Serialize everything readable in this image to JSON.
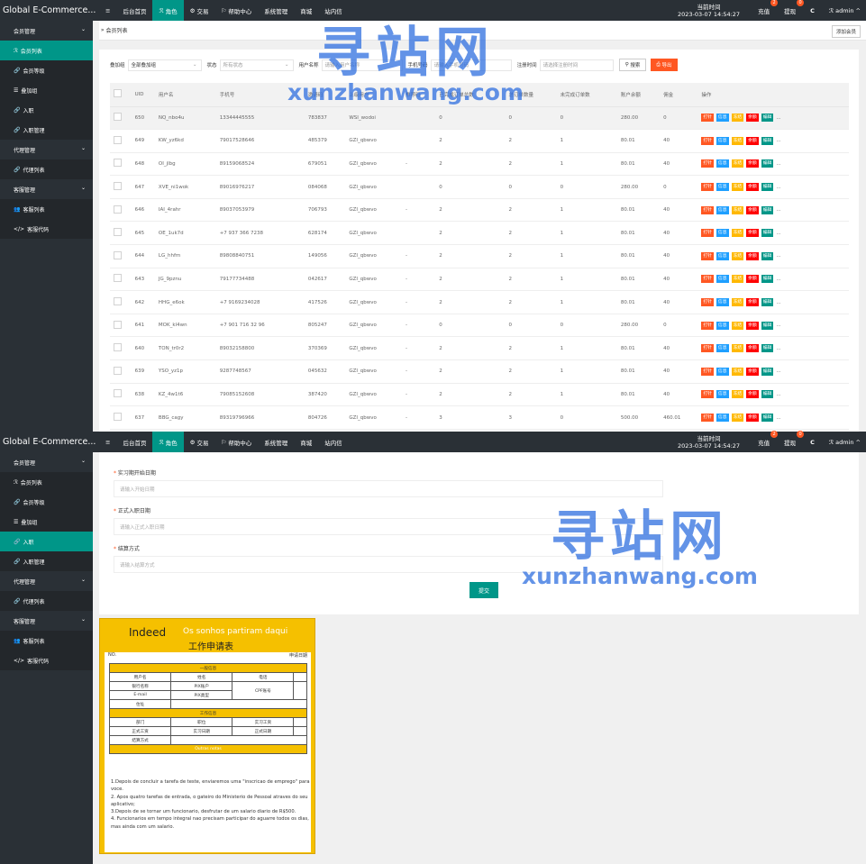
{
  "app": {
    "brand": "Global E-Commerce..."
  },
  "nav": [
    {
      "icon": "≡",
      "label": ""
    },
    {
      "icon": "",
      "label": "后台首页"
    },
    {
      "icon": "ℛ",
      "label": "角色"
    },
    {
      "icon": "⚙",
      "label": "交易"
    },
    {
      "icon": "⚐",
      "label": "帮助中心"
    },
    {
      "icon": "",
      "label": "系统管理"
    },
    {
      "icon": "",
      "label": "商城"
    },
    {
      "icon": "",
      "label": "站内信"
    }
  ],
  "top_right": {
    "time_label": "当前时间",
    "time_value": "2023-03-07 14:54:27",
    "recharge": "充值",
    "recharge_badge": "2",
    "withdraw": "提现",
    "withdraw_badge": "0",
    "refresh_icon": "C",
    "user": "admin"
  },
  "sidebar1": [
    {
      "label": "会员管理",
      "icon": "",
      "type": "group"
    },
    {
      "label": "会员列表",
      "icon": "ℛ",
      "type": "active"
    },
    {
      "label": "会员等级",
      "icon": "🔗",
      "type": "dark"
    },
    {
      "label": "叠加组",
      "icon": "☰",
      "type": "dark"
    },
    {
      "label": "入职",
      "icon": "🔗",
      "type": "dark"
    },
    {
      "label": "入职管理",
      "icon": "🔗",
      "type": "dark"
    },
    {
      "label": "代理管理",
      "icon": "",
      "type": "group"
    },
    {
      "label": "代理列表",
      "icon": "🔗",
      "type": "dark"
    },
    {
      "label": "客服管理",
      "icon": "",
      "type": "group"
    },
    {
      "label": "客服列表",
      "icon": "👥",
      "type": "dark"
    },
    {
      "label": "客服代码",
      "icon": "</>",
      "type": "dark"
    }
  ],
  "sidebar2": [
    {
      "label": "会员管理",
      "icon": "",
      "type": "group"
    },
    {
      "label": "会员列表",
      "icon": "ℛ",
      "type": "dark"
    },
    {
      "label": "会员等级",
      "icon": "🔗",
      "type": "dark"
    },
    {
      "label": "叠加组",
      "icon": "☰",
      "type": "dark"
    },
    {
      "label": "入职",
      "icon": "🔗",
      "type": "active"
    },
    {
      "label": "入职管理",
      "icon": "🔗",
      "type": "dark"
    },
    {
      "label": "代理管理",
      "icon": "",
      "type": "group"
    },
    {
      "label": "代理列表",
      "icon": "🔗",
      "type": "dark"
    },
    {
      "label": "客服管理",
      "icon": "",
      "type": "group"
    },
    {
      "label": "客服列表",
      "icon": "👥",
      "type": "dark"
    },
    {
      "label": "客服代码",
      "icon": "</>",
      "type": "dark"
    }
  ],
  "breadcrumb": "会员列表",
  "add_member": "添加会员",
  "filters": {
    "group_label": "叠加组",
    "group_value": "全部叠加组",
    "status_label": "状态",
    "status_value": "所有状态",
    "user_label": "用户名称",
    "user_placeholder": "请输入用户名称",
    "phone_label": "手机号码",
    "phone_placeholder": "请输入手机号码",
    "reg_label": "注册时间",
    "reg_placeholder": "请选择注册时间",
    "search": "搜索",
    "export": "导出"
  },
  "table": {
    "headers": [
      "",
      "UID",
      "用户名",
      "手机号",
      "邀请码",
      "上级用户",
      "推荐码",
      "已完成订单总数",
      "总订单数量",
      "未完成订单数",
      "账户余额",
      "佣金",
      "操作"
    ],
    "rows": [
      [
        "650",
        "NQ_nbo4u",
        "13344445555",
        "783837",
        "WSI_wodoi",
        "",
        "0",
        "0",
        "0",
        "280.00",
        "0"
      ],
      [
        "649",
        "KW_yz6kd",
        "79017528646",
        "485379",
        "GZI_qbwvo",
        "",
        "2",
        "2",
        "1",
        "80.01",
        "40"
      ],
      [
        "648",
        "OI_jlbg",
        "89159068524",
        "679051",
        "GZI_qbwvo",
        "-",
        "2",
        "2",
        "1",
        "80.01",
        "40"
      ],
      [
        "647",
        "XVE_ni1wok",
        "89016976217",
        "084068",
        "GZI_qbwvo",
        "",
        "0",
        "0",
        "0",
        "280.00",
        "0"
      ],
      [
        "646",
        "IAI_4rahr",
        "89037053979",
        "706793",
        "GZI_qbwvo",
        "-",
        "2",
        "2",
        "1",
        "80.01",
        "40"
      ],
      [
        "645",
        "OE_1uk7d",
        "+7 937 366 7238",
        "628174",
        "GZI_qbwvo",
        "",
        "2",
        "2",
        "1",
        "80.01",
        "40"
      ],
      [
        "644",
        "LG_hhfm",
        "89808840751",
        "149056",
        "GZI_qbwvo",
        "-",
        "2",
        "2",
        "1",
        "80.01",
        "40"
      ],
      [
        "643",
        "JG_9pznu",
        "79177734488",
        "042617",
        "GZI_qbwvo",
        "-",
        "2",
        "2",
        "1",
        "80.01",
        "40"
      ],
      [
        "642",
        "HHG_e6ok",
        "+7 9169234028",
        "417526",
        "GZI_qbwvo",
        "-",
        "2",
        "2",
        "1",
        "80.01",
        "40"
      ],
      [
        "641",
        "MOK_kl4wn",
        "+7 901 716 32 96",
        "805247",
        "GZI_qbwvo",
        "-",
        "0",
        "0",
        "0",
        "280.00",
        "0"
      ],
      [
        "640",
        "TON_tr0r2",
        "89032158800",
        "370369",
        "GZI_qbwvo",
        "-",
        "2",
        "2",
        "1",
        "80.01",
        "40"
      ],
      [
        "639",
        "YSO_yz1p",
        "9287748567",
        "045632",
        "GZI_qbwvo",
        "-",
        "2",
        "2",
        "1",
        "80.01",
        "40"
      ],
      [
        "638",
        "KZ_4w1t6",
        "79085152608",
        "387420",
        "GZI_qbwvo",
        "-",
        "2",
        "2",
        "1",
        "80.01",
        "40"
      ],
      [
        "637",
        "BBG_cagy",
        "89319796966",
        "804726",
        "GZI_qbwvo",
        "-",
        "3",
        "3",
        "0",
        "500.00",
        "460.01"
      ]
    ],
    "ops": [
      {
        "label": "打针",
        "color": "#ff5722"
      },
      {
        "label": "信息",
        "color": "#1e9fff"
      },
      {
        "label": "冻结",
        "color": "#ffb800"
      },
      {
        "label": "余额",
        "color": "#ff0000"
      },
      {
        "label": "编辑",
        "color": "#009688"
      }
    ],
    "more": "..."
  },
  "form": {
    "f1_label": "实习期开始日期",
    "f1_placeholder": "请输入开始日期",
    "f2_label": "正式入职日期",
    "f2_placeholder": "请输入正式入职日期",
    "f3_label": "结算方式",
    "f3_placeholder": "请输入结算方式",
    "submit": "提交"
  },
  "watermark": {
    "cn": "寻站网",
    "en": "xunzhanwang.com"
  },
  "card": {
    "brand": "Indeed",
    "slogan": "Os sonhos partiram daqui",
    "title": "工作申请表",
    "no": "NO.",
    "stamp": "申请日期",
    "sec1": "一般信息",
    "r1": [
      "用户名",
      "姓名",
      "电话"
    ],
    "r2": [
      "银行名称",
      "PIX账户",
      "CPF账号"
    ],
    "r3": [
      "E-mail",
      "PIX类型"
    ],
    "r4": [
      "住址"
    ],
    "sec2": "工作信息",
    "r5": [
      "部门",
      "职位",
      "实习工资"
    ],
    "r6": [
      "正式工资",
      "实习日期",
      "正式日期"
    ],
    "r7": [
      "结算方式"
    ],
    "sec3": "Outras notas",
    "notes": [
      "1.Depois de concluir a tarefa de teste, enviaremos uma \"inscricao de emprego\" para voce.",
      "2. Apos quatro tarefas de entrada, o gateiro do Ministerio de Pessoal atraves do seu aplicativo;",
      "3.Depois de se tornar um funcionario, desfrutar de um salario diario de R$500.",
      "4. Funcionarios em tempo integral nao precisam participar do aguarre todos os dias, mas ainda com um salario."
    ]
  }
}
